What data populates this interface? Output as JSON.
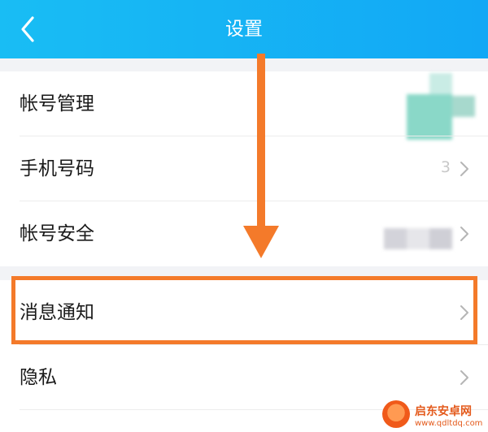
{
  "header": {
    "title": "设置",
    "back_icon": "chevron-left-icon",
    "background": "#15b4f5"
  },
  "settings": {
    "account_management": {
      "label": "帐号管理"
    },
    "phone_number": {
      "label": "手机号码",
      "value_peek": "3"
    },
    "account_security": {
      "label": "帐号安全"
    },
    "message_notifications": {
      "label": "消息通知"
    },
    "privacy": {
      "label": "隐私"
    }
  },
  "annotation": {
    "color": "#f47a2a",
    "highlighted_item": "消息通知"
  },
  "watermark": {
    "name": "启东安卓网",
    "url": "www.qdltdq.com"
  }
}
